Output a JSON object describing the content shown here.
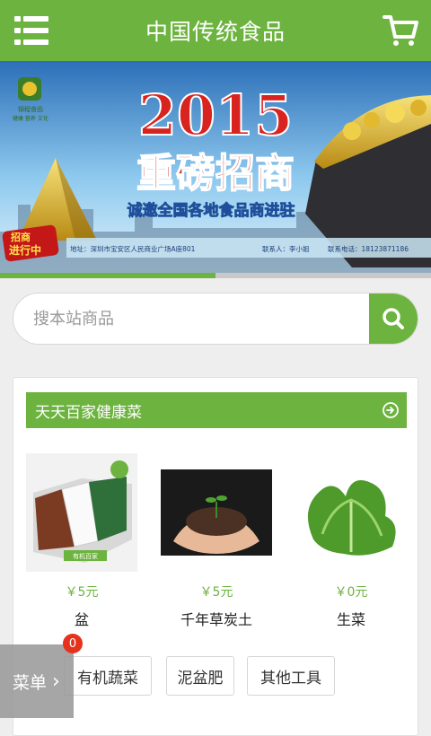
{
  "header": {
    "title": "中国传统食品",
    "menu_icon": "hamburger-menu-icon",
    "cart_icon": "shopping-cart-icon",
    "accent": "#6db33f"
  },
  "banner": {
    "logo_name": "锦程食品",
    "logo_tagline": "健康 营养 文化",
    "year": "2015",
    "headline": "重磅招商",
    "subheadline": "诚邀全国各地食品商进驻",
    "stamp_line1": "招商",
    "stamp_line2": "进行中",
    "address": "地址：深圳市宝安区人民商业广场A座801",
    "contact": "联系人：李小姐",
    "phone": "联系电话：18123871186",
    "slide_progress": 0.5
  },
  "search": {
    "placeholder": "搜本站商品",
    "icon": "search-icon"
  },
  "category": {
    "title": "天天百家健康菜",
    "arrow_icon": "circle-arrow-right-icon"
  },
  "products": [
    {
      "price": "￥5元",
      "name": "盆",
      "img_caption": "有机百家"
    },
    {
      "price": "￥5元",
      "name": "千年草炭土"
    },
    {
      "price": "￥0元",
      "name": "生菜"
    }
  ],
  "tags": [
    {
      "label": "有机蔬菜"
    },
    {
      "label": "泥盆肥"
    },
    {
      "label": "其他工具"
    }
  ],
  "float_menu": {
    "label": "菜单",
    "chevron": "›",
    "badge": "0"
  }
}
